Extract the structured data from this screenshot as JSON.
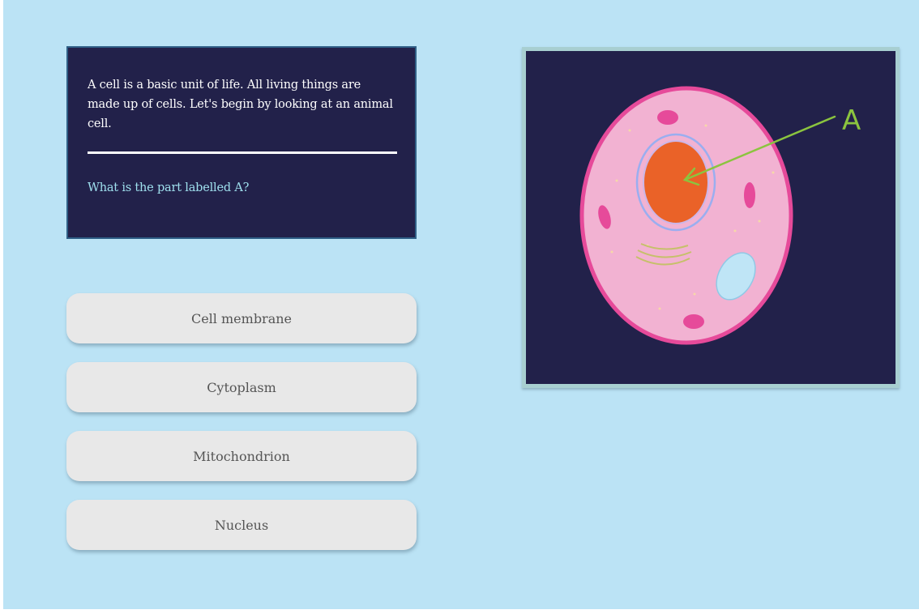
{
  "question_panel": {
    "intro": "A cell is a basic unit of life. All living things are made up of cells. Let's begin by looking at an animal cell.",
    "question": "What is the part labelled A?"
  },
  "answers": [
    {
      "label": "Cell membrane"
    },
    {
      "label": "Cytoplasm"
    },
    {
      "label": "Mitochondrion"
    },
    {
      "label": "Nucleus"
    }
  ],
  "diagram": {
    "label_a": "A",
    "colors": {
      "background": "#22214a",
      "cytoplasm": "#f2b2d2",
      "membrane": "#e64a9a",
      "nucleus": "#ea6228",
      "nuclear_envelope": "#9aaef0",
      "pointer": "#8bc43f",
      "vacuole": "#bfe5f6"
    }
  },
  "colors": {
    "page_background": "#bbe3f5",
    "panel_background": "#22214a",
    "question_text": "#9fe0ee",
    "button_background": "#e8e8e8"
  }
}
